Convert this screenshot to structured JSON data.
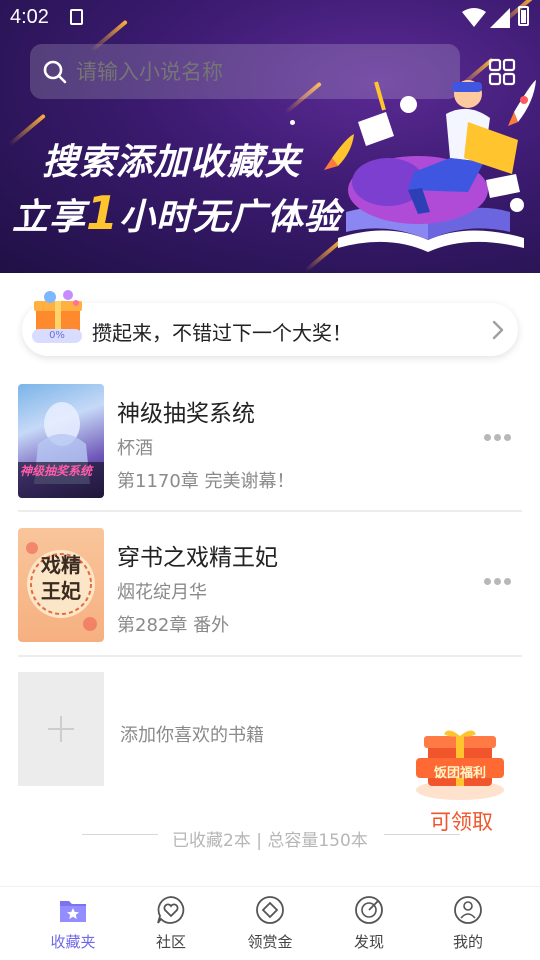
{
  "status_bar": {
    "time": "4:02"
  },
  "search": {
    "placeholder": "请输入小说名称"
  },
  "banner": {
    "line1": "搜索添加收藏夹",
    "line2_prefix": "立享",
    "line2_highlight": "1",
    "line2_suffix": "小时无广体验"
  },
  "lottery": {
    "progress": "0%",
    "text": "攒起来，不错过下一个大奖！"
  },
  "books": [
    {
      "title": "神级抽奖系统",
      "author": "杯酒",
      "chapter": "第1170章 完美谢幕！",
      "cover_text": "神级抽奖系统"
    },
    {
      "title": "穿书之戏精王妃",
      "author": "烟花绽月华",
      "chapter": "第282章 番外",
      "cover_text": "戏精王妃"
    }
  ],
  "add_book": {
    "text": "添加你喜欢的书籍"
  },
  "welfare": {
    "badge": "饭团福利",
    "action": "可领取"
  },
  "stats": {
    "text": "已收藏2本 | 总容量150本"
  },
  "nav": [
    {
      "label": "收藏夹",
      "icon": "bookmark-folder-icon",
      "active": true
    },
    {
      "label": "社区",
      "icon": "heart-chat-icon",
      "active": false
    },
    {
      "label": "领赏金",
      "icon": "diamond-icon",
      "active": false
    },
    {
      "label": "发现",
      "icon": "compass-icon",
      "active": false
    },
    {
      "label": "我的",
      "icon": "user-icon",
      "active": false
    }
  ],
  "colors": {
    "accent": "#6f69e8",
    "banner_bg": "#3a1a6e",
    "highlight": "#ffc42e",
    "welfare": "#f0552c"
  }
}
